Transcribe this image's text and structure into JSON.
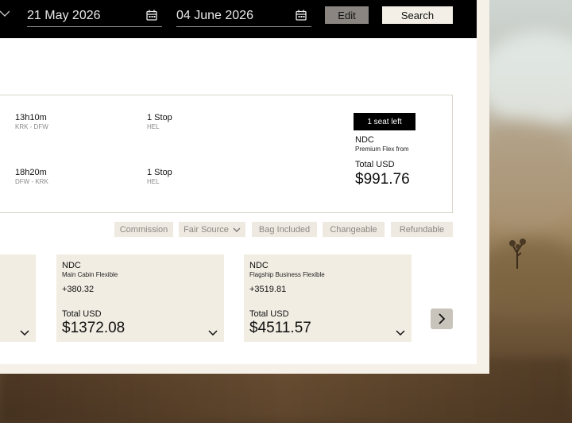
{
  "search": {
    "depart_date": "21 May 2026",
    "return_date": "04 June 2026",
    "edit_label": "Edit",
    "search_label": "Search"
  },
  "flight": {
    "legs": [
      {
        "duration": "13h10m",
        "route": "KRK - DFW",
        "stops": "1 Stop",
        "via": "HEL"
      },
      {
        "duration": "18h20m",
        "route": "DFW - KRK",
        "stops": "1 Stop",
        "via": "HEL"
      }
    ],
    "seats_badge": "1 seat left",
    "fare_source": "NDC",
    "fare_name": "Premium Flex from",
    "total_label": "Total USD",
    "price": "$991.76"
  },
  "filters": [
    "Commission",
    "Fair Source",
    "Bag Included",
    "Changeable",
    "Refundable"
  ],
  "fares": [
    {
      "source": "NDC",
      "name": "Main Cabin Flexible",
      "delta": "+380.32",
      "total_label": "Total USD",
      "price": "$1372.08"
    },
    {
      "source": "NDC",
      "name": "Flagship Business Flexible",
      "delta": "+3519.81",
      "total_label": "Total USD",
      "price": "$4511.57"
    }
  ],
  "colors": {
    "topbar": "#000000",
    "badge": "#000000",
    "chip": "#efeae1",
    "fare_box": "#f2ede3",
    "edit_button": "#8a8580"
  },
  "icons": {
    "calendar": "calendar-icon",
    "chevron_down": "chevron-down-icon",
    "chevron_right": "chevron-right-icon"
  }
}
